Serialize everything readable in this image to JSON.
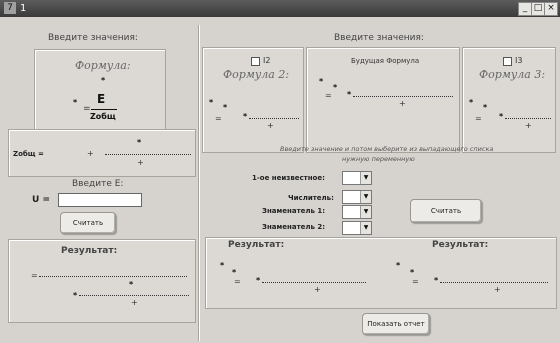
{
  "window": {
    "app_icon": "7",
    "title": "1",
    "buttons": [
      "_",
      "□",
      "×"
    ]
  },
  "left": {
    "heading": "Введите значения:",
    "formula_title": "Формула:",
    "formula_numerator": "E",
    "formula_denominator": "Zобщ",
    "formula_eq": "=",
    "zobsh_label": "Zобщ =",
    "zobsh_plus": "+",
    "input_heading": "Введите E:",
    "u_label": "U =",
    "u_value": "",
    "calc_button": "Считать",
    "result_heading": "Результат:",
    "result_eq": "=",
    "result_plus": "+"
  },
  "right": {
    "heading": "Введите значения:",
    "i2_label": "I2",
    "formula2_title": "Формула 2:",
    "future_title": "Будущая Формула",
    "i3_label": "I3",
    "formula3_title": "Формула 3:",
    "eq": "=",
    "plus": "+",
    "instruction_line1": "Введите значение и потом выберите из выпадающего списка",
    "instruction_line2": "нужную переменную",
    "fields": [
      {
        "label": "1-ое неизвестное:",
        "value": ""
      },
      {
        "label": "Числитель:",
        "value": ""
      },
      {
        "label": "Знаменатель 1:",
        "value": ""
      },
      {
        "label": "Знаменатель 2:",
        "value": ""
      }
    ],
    "calc_button": "Считать",
    "result1_heading": "Результат:",
    "result2_heading": "Результат:",
    "report_button": "Показать отчет"
  },
  "symbols": {
    "star": "*",
    "arrow": "▼"
  }
}
